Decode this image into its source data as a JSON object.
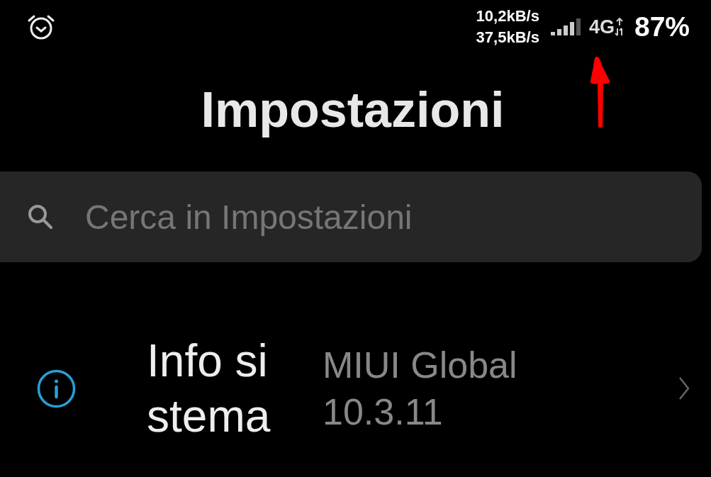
{
  "status_bar": {
    "upload_speed": "10,2kB/s",
    "download_speed": "37,5kB/s",
    "network": "4G",
    "battery": "87%"
  },
  "title": "Impostazioni",
  "search": {
    "placeholder": "Cerca in Impostazioni"
  },
  "items": [
    {
      "label": "Info sistema",
      "value": "MIUI Global 10.3.11"
    }
  ]
}
